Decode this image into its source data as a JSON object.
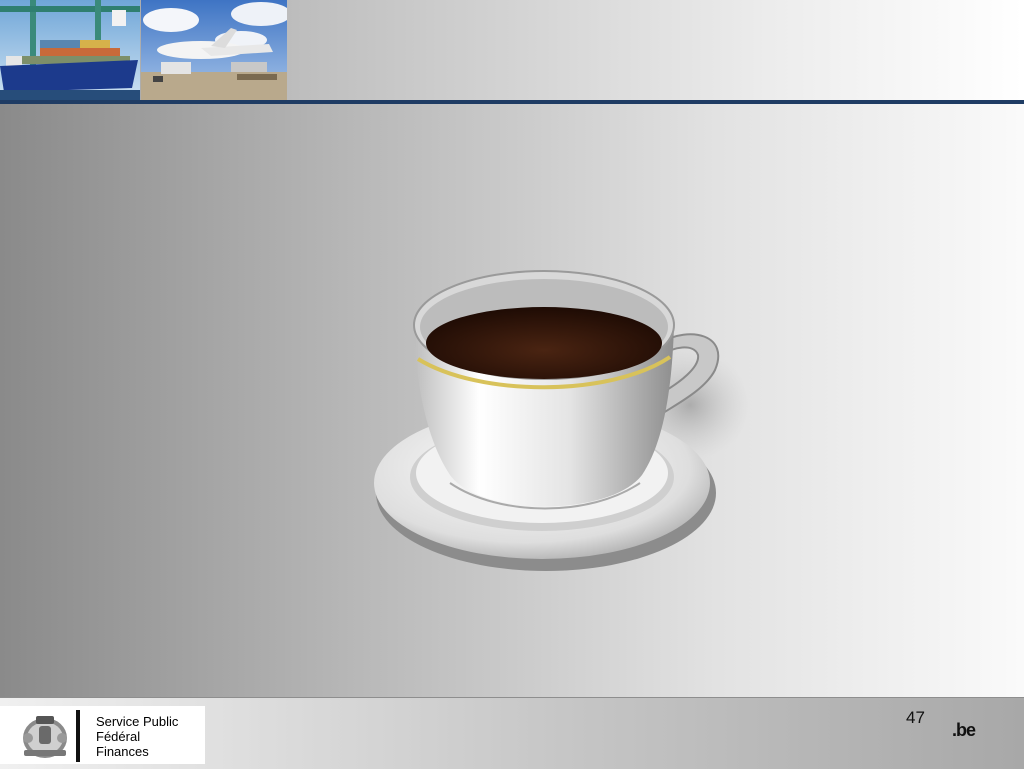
{
  "footer": {
    "org_lines": [
      "Service Public",
      "Fédéral",
      "Finances"
    ],
    "page_number": "47",
    "domain_badge": ".be"
  },
  "colors": {
    "header_line": "#1f3c64",
    "coffee": "#3a1a0c",
    "gold_band": "#d8c25a"
  },
  "icons": {
    "header_photo_1": "container-ship-photo",
    "header_photo_2": "cargo-plane-photo",
    "main_image": "coffee-cup-icon",
    "logo": "belgian-coat-of-arms-icon"
  }
}
